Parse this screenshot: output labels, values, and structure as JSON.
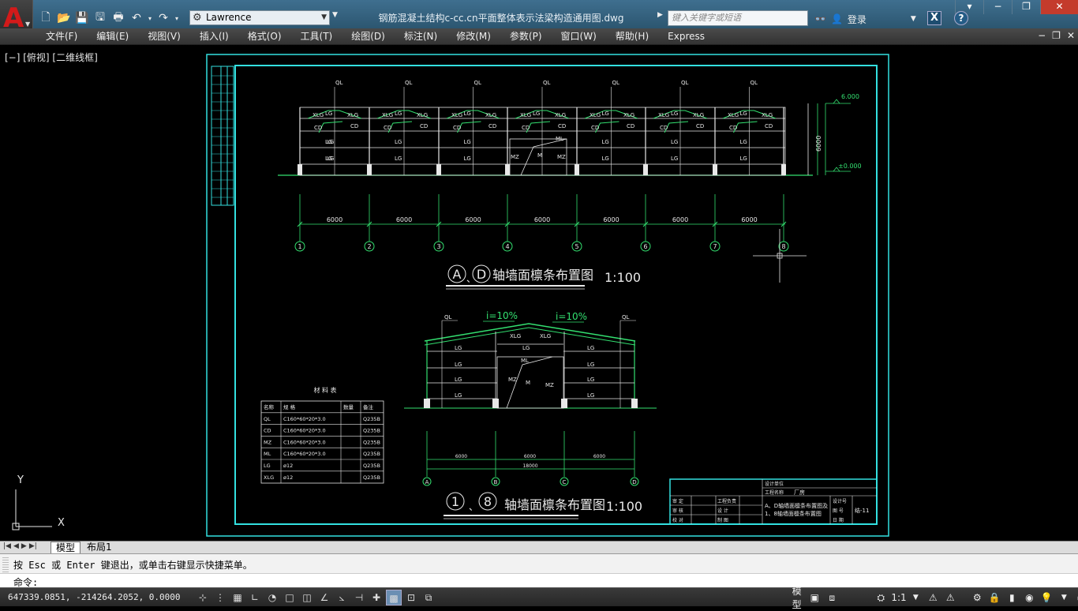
{
  "app": {
    "logo_letter": "A",
    "workspace": "Lawrence",
    "document_title": "钢筋混凝土结构c-cc.cn平面整体表示法梁构造通用图.dwg",
    "search_placeholder": "键入关键字或短语",
    "login_label": "登录",
    "x_label": "X",
    "help_label": "?"
  },
  "menu": [
    "文件(F)",
    "编辑(E)",
    "视图(V)",
    "插入(I)",
    "格式(O)",
    "工具(T)",
    "绘图(D)",
    "标注(N)",
    "修改(M)",
    "参数(P)",
    "窗口(W)",
    "帮助(H)",
    "Express"
  ],
  "viewport": {
    "label": "[−] [俯视] [二维线框]"
  },
  "ucs": {
    "x": "X",
    "y": "Y"
  },
  "drawing": {
    "elev1_title_a": "A",
    "elev1_title_d": "D",
    "elev1_sep": "、",
    "elev1_title": "轴墙面檩条布置图",
    "elev1_scale": "1:100",
    "elev2_title_1": "1",
    "elev2_title_8": "8",
    "elev2_sep": "、",
    "elev2_title": "轴墙面檩条布置图",
    "elev2_scale": "1:100",
    "dims_bays": [
      "6000",
      "6000",
      "6000",
      "6000",
      "6000",
      "6000",
      "6000"
    ],
    "axes_num": [
      "1",
      "2",
      "3",
      "4",
      "5",
      "6",
      "7",
      "8"
    ],
    "axes_letter": [
      "A",
      "B",
      "C",
      "D"
    ],
    "dims_gable": [
      "6000",
      "6000",
      "6000"
    ],
    "dim_gable_total": "18000",
    "level_top": "6.000",
    "level_zero": "±0.000",
    "height_total": "6000",
    "slope_left": "i=10%",
    "slope_right": "i=10%",
    "labels": {
      "ql": "QL",
      "lg": "LG",
      "xlg": "XLG",
      "cd": "CD",
      "mz": "MZ",
      "ml": "ML",
      "m": "M"
    },
    "material_table": {
      "title": "材 料 表",
      "headers": [
        "名称",
        "规  格",
        "数量",
        "备注"
      ],
      "rows": [
        [
          "QL",
          "C160*60*20*3.0",
          "",
          "Q235B"
        ],
        [
          "CD",
          "C160*60*20*3.0",
          "",
          "Q235B"
        ],
        [
          "MZ",
          "C160*60*20*3.0",
          "",
          "Q235B"
        ],
        [
          "ML",
          "C160*60*20*3.0",
          "",
          "Q235B"
        ],
        [
          "LG",
          "ø12",
          "",
          "Q235B"
        ],
        [
          "XLG",
          "ø12",
          "",
          "Q235B"
        ]
      ]
    },
    "title_block": {
      "company": "设计单位",
      "project_label": "工程名称",
      "project": "厂房",
      "drawing_name_1": "A、D轴墙面檩条布置图及",
      "drawing_name_2": "1、8轴墙面檩条布置图",
      "roles_left": [
        "审 定",
        "审 核",
        "校 对"
      ],
      "roles_mid": [
        "工程负责",
        "设 计",
        "制 图"
      ],
      "right": [
        "设计号",
        "图 号",
        "日 期"
      ],
      "sheet_no": "结-11"
    }
  },
  "tabs": {
    "model": "模型",
    "layout1": "布局1"
  },
  "command": {
    "history": "按 Esc 或 Enter 键退出，或单击右键显示快捷菜单。",
    "prompt": "命令:"
  },
  "status": {
    "coords": "647339.0851, -214264.2052, 0.0000",
    "model_label": "模型",
    "scale": "1:1"
  }
}
